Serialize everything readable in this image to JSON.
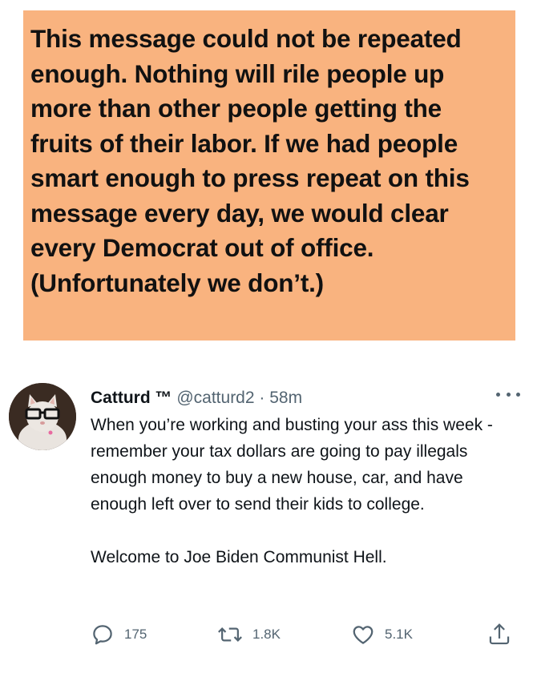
{
  "banner": {
    "text": "This message could not be repeated enough. Nothing will rile people up more than other people getting the fruits of their labor. If we had people smart enough to press repeat on this message every day, we would clear every Democrat out of office. (Unfortunately we don’t.)",
    "background": "#f9b37f"
  },
  "tweet": {
    "display_name": "Catturd ™",
    "handle": "@catturd2",
    "separator": "·",
    "time": "58m",
    "paragraphs": [
      "When you’re working and busting your ass this week - remember your tax dollars are going to pay illegals enough money to buy a new house, car, and have enough left over to send their kids to college.",
      "Welcome to Joe Biden Communist Hell."
    ],
    "actions": {
      "reply_count": "175",
      "retweet_count": "1.8K",
      "like_count": "5.1K"
    },
    "icons": [
      "more-icon",
      "reply-icon",
      "retweet-icon",
      "like-icon",
      "share-icon"
    ],
    "colors": {
      "text": "#0f1419",
      "secondary": "#536471"
    }
  }
}
